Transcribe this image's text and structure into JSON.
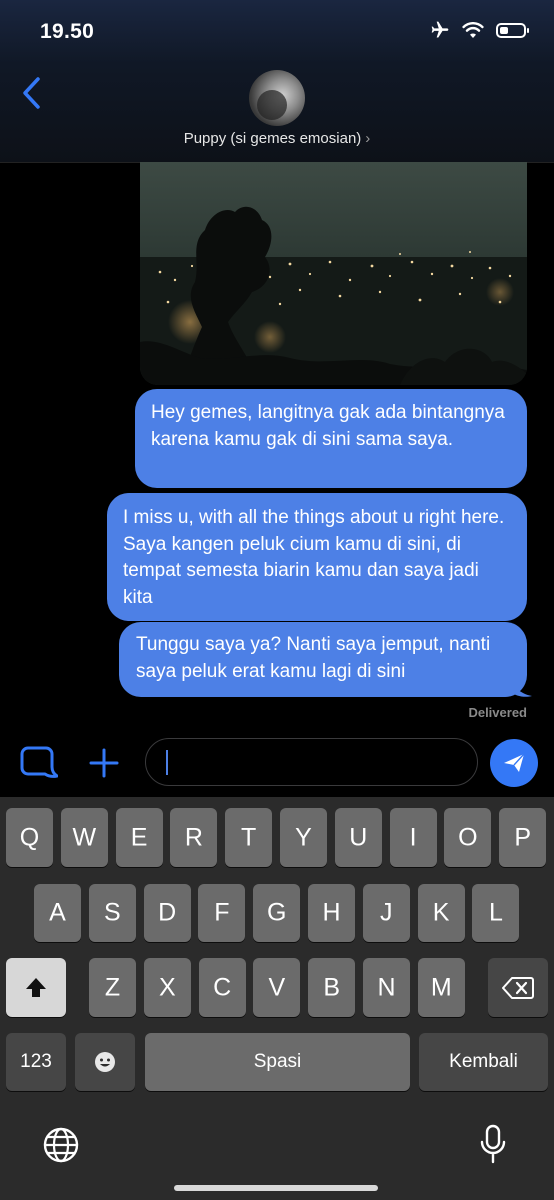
{
  "status_bar": {
    "time": "19.50",
    "battery_level": 0.2
  },
  "header": {
    "contact_name": "Puppy (si gemes emosian)",
    "chevron": "›"
  },
  "messages": [
    "Hey gemes, langitnya gak ada bintangnya karena kamu gak di sini sama saya.",
    "I miss u, with all the things about u right here. Saya kangen peluk cium kamu di sini, di tempat semesta biarin kamu dan saya jadi kita",
    "Tunggu saya ya? Nanti saya jemput, nanti saya peluk erat kamu lagi di sini"
  ],
  "delivery_status": "Delivered",
  "input": {
    "value": ""
  },
  "keyboard": {
    "row1": [
      "Q",
      "W",
      "E",
      "R",
      "T",
      "Y",
      "U",
      "I",
      "O",
      "P"
    ],
    "row2": [
      "A",
      "S",
      "D",
      "F",
      "G",
      "H",
      "J",
      "K",
      "L"
    ],
    "row3": [
      "Z",
      "X",
      "C",
      "V",
      "B",
      "N",
      "M"
    ],
    "numbers_label": "123",
    "space_label": "Spasi",
    "return_label": "Kembali"
  },
  "colors": {
    "bubble": "#4d80e6",
    "accent": "#3478f6",
    "keyboard_bg": "#2b2b2b"
  },
  "icons": [
    "airplane-icon",
    "wifi-icon",
    "battery-icon",
    "back-chevron-icon",
    "app-store-icon",
    "plus-icon",
    "send-icon",
    "shift-icon",
    "backspace-icon",
    "emoji-icon",
    "globe-icon",
    "microphone-icon"
  ]
}
